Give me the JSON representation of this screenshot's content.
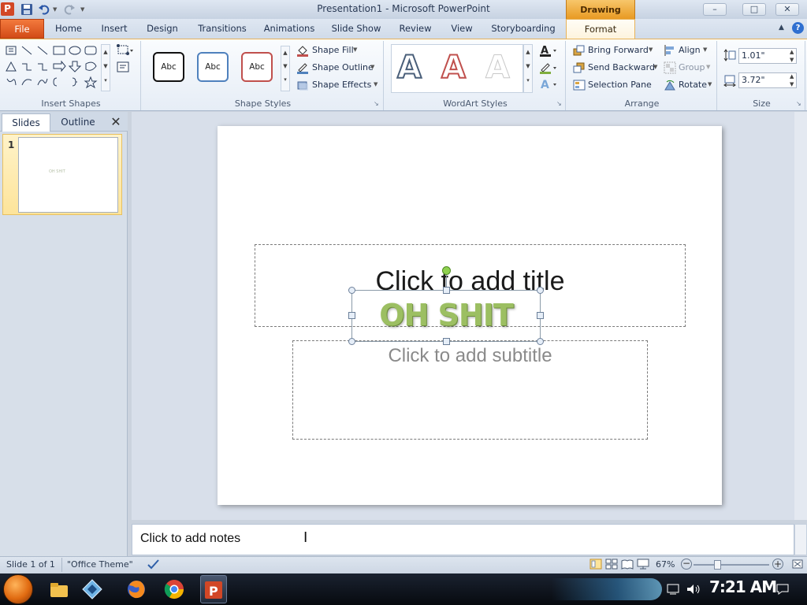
{
  "window": {
    "title": "Presentation1 - Microsoft PowerPoint",
    "app_icon_letter": "P",
    "contextual_band": "Drawing Tools",
    "buttons": {
      "minimize": "–",
      "maximize": "□",
      "close": "✕"
    }
  },
  "quick_access": [
    "save-icon",
    "undo-icon",
    "redo-icon",
    "customize-icon"
  ],
  "tabs": [
    {
      "label": "File"
    },
    {
      "label": "Home"
    },
    {
      "label": "Insert"
    },
    {
      "label": "Design"
    },
    {
      "label": "Transitions"
    },
    {
      "label": "Animations"
    },
    {
      "label": "Slide Show"
    },
    {
      "label": "Review"
    },
    {
      "label": "View"
    },
    {
      "label": "Storyboarding"
    },
    {
      "label": "Format"
    }
  ],
  "ribbon": {
    "groups": {
      "insert_shapes": "Insert Shapes",
      "shape_styles": "Shape Styles",
      "wordart_styles": "WordArt Styles",
      "arrange": "Arrange",
      "size": "Size"
    },
    "style_samples": [
      "Abc",
      "Abc",
      "Abc"
    ],
    "shape_fill": "Shape Fill",
    "shape_outline": "Shape Outline",
    "shape_effects": "Shape Effects",
    "wordart_sample": "A",
    "bring_forward": "Bring Forward",
    "send_backward": "Send Backward",
    "selection_pane": "Selection Pane",
    "align": "Align",
    "group": "Group",
    "rotate": "Rotate",
    "height": "1.01\"",
    "width": "3.72\""
  },
  "pane": {
    "tab_slides": "Slides",
    "tab_outline": "Outline",
    "close": "✕",
    "thumb_number": "1",
    "thumb_text": "OH SHIT"
  },
  "slide": {
    "title_placeholder": "Click to add title",
    "subtitle_placeholder": "Click to add subtitle",
    "wordart_text": "OH SHIT"
  },
  "notes": {
    "placeholder": "Click to add notes"
  },
  "status": {
    "slide_info": "Slide 1 of 1",
    "theme": "\"Office Theme\"",
    "zoom": "67%"
  },
  "taskbar": {
    "apps": [
      "file-explorer-icon",
      "network-icon",
      "firefox-icon",
      "chrome-icon",
      "powerpoint-icon"
    ],
    "clock": "7:21 AM"
  },
  "colors": {
    "file_tab": "#d24a17",
    "contextual_orange": "#e89a23",
    "wordart_green": "#9cbf62",
    "rotation_handle": "#8fd14f"
  }
}
